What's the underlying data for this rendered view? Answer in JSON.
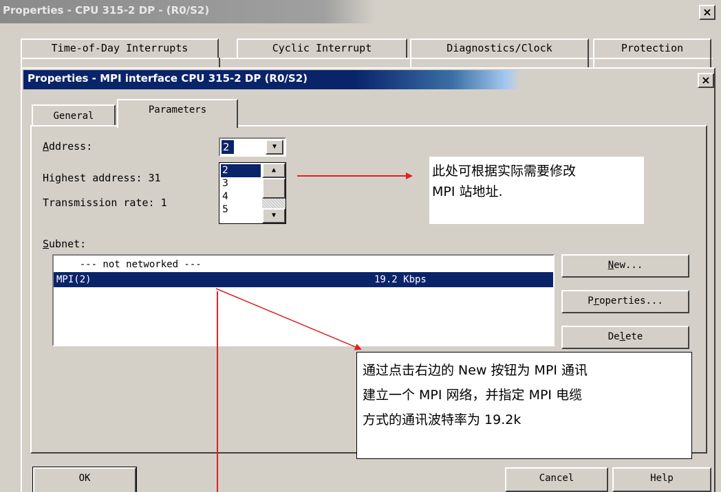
{
  "outer_window": {
    "title": "Properties - CPU 315-2 DP - (R0/S2)",
    "close_label": "×",
    "tabs": [
      "Time-of-Day Interrupts",
      "Cyclic Interrupt",
      "Diagnostics/Clock",
      "Protection"
    ]
  },
  "inner_dialog": {
    "title": "Properties - MPI interface  CPU 315-2 DP (R0/S2)",
    "close_label": "×",
    "tabs": {
      "general": "General",
      "parameters": "Parameters"
    },
    "active_tab": "Parameters",
    "address": {
      "label_first": "A",
      "label_rest": "ddress:",
      "value": "2",
      "options": [
        "2",
        "3",
        "4",
        "5"
      ]
    },
    "highest_address": {
      "label": "Highest address:",
      "value_partial": "31"
    },
    "transmission_rate": {
      "label": "Transmission rate:",
      "value_partial": "1"
    },
    "subnet": {
      "label_first": "S",
      "label_rest": "ubnet:",
      "rows": [
        {
          "name": "    --- not networked ---",
          "rate": ""
        },
        {
          "name": "MPI(2)",
          "rate": "19.2 Kbps"
        }
      ],
      "selected_row": 1
    },
    "buttons": {
      "new_first": "N",
      "new_rest": "ew...",
      "props_a": "P",
      "props_b": "r",
      "props_c": "operties...",
      "delete_a": "De",
      "delete_b": "l",
      "delete_c": "ete",
      "ok": "OK",
      "cancel": "Cancel",
      "help": "Help"
    }
  },
  "annotations": {
    "note1": [
      "此处可根据实际需要修改",
      "MPI 站地址."
    ],
    "note2": [
      "通过点击右边的 New 按钮为 MPI 通讯",
      "建立一个 MPI 网络，并指定 MPI 电缆",
      "方式的通讯波特率为 19.2k"
    ],
    "arrow_color": "#e02020"
  },
  "colors": {
    "titlebar_active": "#0a246a",
    "face": "#d4d0c8",
    "selection": "#0a246a"
  }
}
